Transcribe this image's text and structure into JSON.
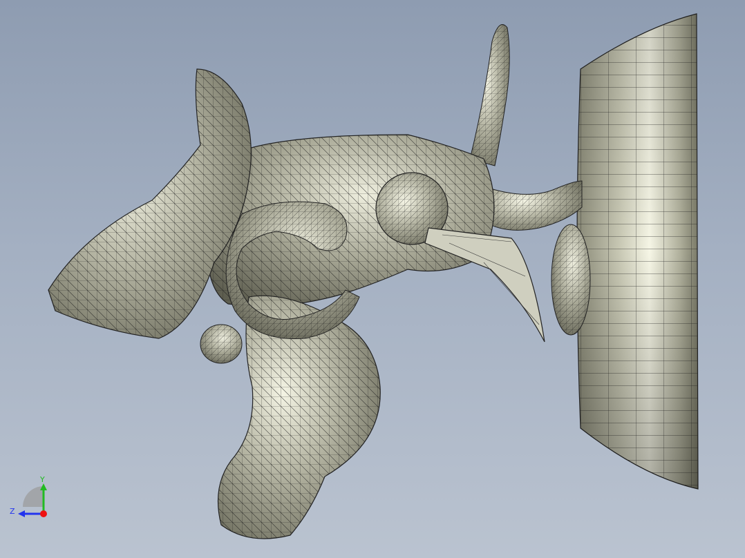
{
  "viewport": {
    "background_top": "#8e9cb1",
    "background_bottom": "#bac3d0",
    "model_fill": "#8f8f7e",
    "model_highlight": "#f4f4e4",
    "mesh_color": "#1a1a1a"
  },
  "triad": {
    "y_label": "Y",
    "z_label": "Z",
    "y_color": "#22bb22",
    "z_color": "#2233ee",
    "x_color": "#ee1111"
  }
}
